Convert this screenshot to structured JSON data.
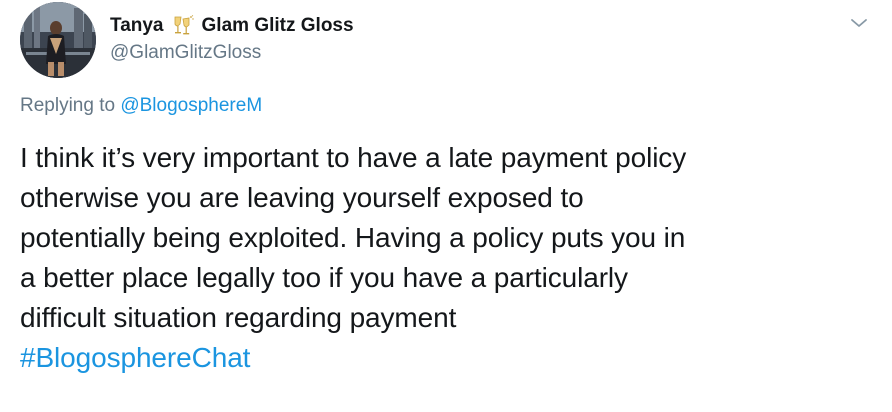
{
  "tweet": {
    "display_name": "Tanya",
    "name_emoji": "champagne-glasses-icon",
    "display_name_suffix": "Glam Glitz Gloss",
    "handle": "@GlamGlitzGloss",
    "replying_prefix": "Replying to",
    "replying_to": "@BlogosphereM",
    "text_lines": [
      "I think it’s very important to have a late payment policy",
      "otherwise you are leaving yourself exposed to",
      "potentially being exploited. Having a policy puts you in",
      "a better place legally too if you have a particularly",
      "difficult situation regarding payment"
    ],
    "hashtag": "#BlogosphereChat",
    "more_icon": "chevron-down-icon"
  },
  "colors": {
    "text": "#14171a",
    "secondary": "#657786",
    "link": "#1b95e0",
    "background": "#ffffff"
  }
}
